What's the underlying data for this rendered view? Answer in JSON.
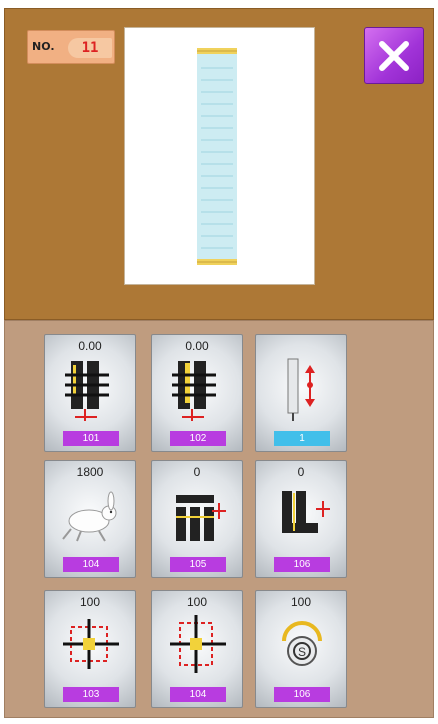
{
  "header": {
    "no_label": "NO.",
    "no_value": "11"
  },
  "params": [
    {
      "value": "0.00",
      "code": "101",
      "icon": "left-thread-tension-icon"
    },
    {
      "value": "0.00",
      "code": "102",
      "icon": "right-thread-tension-icon"
    },
    {
      "value": "",
      "code": "1",
      "icon": "needle-position-icon"
    },
    {
      "value": "1800",
      "code": "104",
      "icon": "sewing-speed-rabbit-icon"
    },
    {
      "value": "0",
      "code": "105",
      "icon": "stitch-width-right-icon"
    },
    {
      "value": "0",
      "code": "106",
      "icon": "stitch-width-left-icon"
    },
    {
      "value": "100",
      "code": "103",
      "icon": "pattern-scale-x-icon"
    },
    {
      "value": "100",
      "code": "104",
      "icon": "pattern-scale-y-icon"
    },
    {
      "value": "100",
      "code": "106",
      "icon": "thread-trim-reset-icon"
    }
  ],
  "colors": {
    "top_panel": "#ad7836",
    "bottom_panel": "#bf9c7f",
    "code_purple": "#b83ce0",
    "code_blue": "#41bfea",
    "close_purple": "#a133d8"
  }
}
